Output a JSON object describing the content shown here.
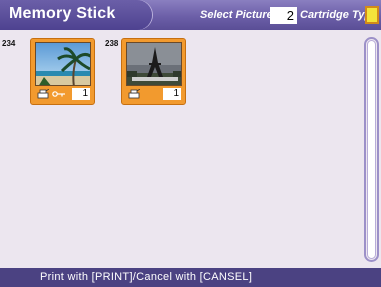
{
  "header": {
    "title": "Memory Stick",
    "select_label": "Select Pictures",
    "select_count": "2",
    "cartridge_label": "Cartridge Type",
    "cartridge_icon": "cartridge-icon",
    "accent_color": "#f4e43a"
  },
  "thumbnails": [
    {
      "number": "234",
      "count": "1",
      "image": "beach-palm-tree",
      "has_print_icon": true,
      "has_protect_icon": true
    },
    {
      "number": "238",
      "count": "1",
      "image": "eiffel-tower",
      "has_print_icon": true,
      "has_protect_icon": false
    }
  ],
  "footer": {
    "text": "Print with [PRINT]/Cancel with [CANSEL]"
  },
  "colors": {
    "header": "#6c5fa8",
    "card": "#f29a2e",
    "footer": "#4b4282",
    "background": "#ece6ef"
  }
}
